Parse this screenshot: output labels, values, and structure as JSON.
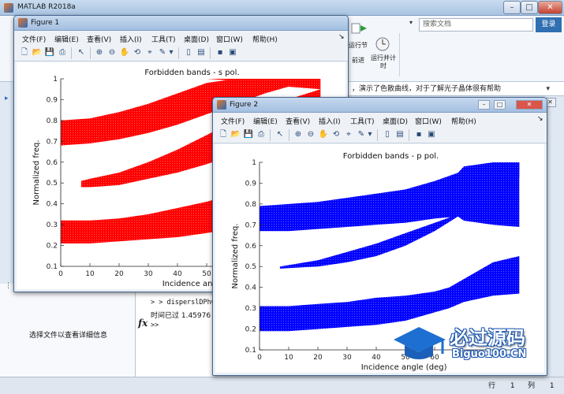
{
  "main_window": {
    "title": "MATLAB R2018a",
    "search_placeholder": "搜索文档",
    "login_label": "登录",
    "ribbon": {
      "run_section_label": "运行节",
      "advance_label": "前进",
      "run_timer_label": "运行并计时"
    },
    "address_text": "，演示了色散曲线，对于了解光子晶体很有帮助",
    "left_panel_text": "选择文件以查看详细信息",
    "command_lines": [
      "> > disperslDPhC",
      "时间已过 1.45976",
      ">>"
    ],
    "status": {
      "row_label": "行",
      "row_value": "1",
      "col_label": "列",
      "col_value": "1"
    }
  },
  "figure_menu": [
    "文件(F)",
    "编辑(E)",
    "查看(V)",
    "插入(I)",
    "工具(T)",
    "桌面(D)",
    "窗口(W)",
    "帮助(H)"
  ],
  "figure1": {
    "title": "Figure 1",
    "chart_data": {
      "type": "scatter",
      "title": "Forbidden bands - s pol.",
      "xlabel": "Incidence angle (deg)",
      "ylabel": "Normalized freq.",
      "xlim": [
        0,
        90
      ],
      "ylim": [
        0.1,
        1.0
      ],
      "xticks": [
        0,
        10,
        20,
        30,
        40,
        50,
        60
      ],
      "yticks": [
        0.1,
        0.2,
        0.3,
        0.4,
        0.5,
        0.6,
        0.7,
        0.8,
        0.9,
        1
      ],
      "color": "#ff0000",
      "bands": [
        {
          "x": [
            0,
            10,
            20,
            30,
            40,
            50,
            60,
            70,
            80,
            89
          ],
          "lower": [
            0.21,
            0.21,
            0.22,
            0.23,
            0.24,
            0.26,
            0.28,
            0.31,
            0.33,
            0.34
          ],
          "upper": [
            0.32,
            0.32,
            0.33,
            0.35,
            0.38,
            0.41,
            0.45,
            0.49,
            0.52,
            0.54
          ]
        },
        {
          "x": [
            7,
            10,
            20,
            30,
            40,
            50,
            60,
            70,
            80,
            89
          ],
          "lower": [
            0.48,
            0.48,
            0.49,
            0.52,
            0.55,
            0.59,
            0.64,
            0.68,
            0.71,
            0.73
          ],
          "upper": [
            0.51,
            0.52,
            0.55,
            0.6,
            0.66,
            0.73,
            0.8,
            0.86,
            0.91,
            0.95
          ]
        },
        {
          "x": [
            0,
            10,
            20,
            30,
            40,
            50,
            60,
            70,
            80,
            89
          ],
          "lower": [
            0.68,
            0.69,
            0.71,
            0.74,
            0.78,
            0.83,
            0.88,
            0.93,
            0.97,
            1.0
          ],
          "upper": [
            0.8,
            0.81,
            0.84,
            0.88,
            0.93,
            0.98,
            1.0,
            1.0,
            1.0,
            1.0
          ]
        },
        {
          "x": [
            50,
            60,
            70,
            80,
            89
          ],
          "lower": [
            1.0,
            0.99,
            0.97,
            0.96,
            0.95
          ],
          "upper": [
            1.0,
            1.0,
            1.0,
            1.0,
            1.0
          ]
        }
      ]
    }
  },
  "figure2": {
    "title": "Figure 2",
    "chart_data": {
      "type": "scatter",
      "title": "Forbidden bands - p pol.",
      "xlabel": "Incidence angle (deg)",
      "ylabel": "Normalized freq.",
      "xlim": [
        0,
        90
      ],
      "ylim": [
        0.1,
        1.0
      ],
      "xticks": [
        0,
        10,
        20,
        30,
        40,
        50,
        60
      ],
      "yticks": [
        0.1,
        0.2,
        0.3,
        0.4,
        0.5,
        0.6,
        0.7,
        0.8,
        0.9,
        1
      ],
      "color": "#0000ff",
      "bands": [
        {
          "x": [
            0,
            10,
            20,
            30,
            40,
            50,
            60,
            65,
            70,
            80,
            89
          ],
          "lower": [
            0.19,
            0.19,
            0.2,
            0.21,
            0.22,
            0.24,
            0.28,
            0.3,
            0.33,
            0.36,
            0.37
          ],
          "upper": [
            0.31,
            0.31,
            0.32,
            0.33,
            0.35,
            0.36,
            0.38,
            0.4,
            0.44,
            0.52,
            0.55
          ]
        },
        {
          "x": [
            7,
            20,
            30,
            40,
            50,
            60,
            68,
            70,
            80,
            89
          ],
          "lower": [
            0.49,
            0.5,
            0.52,
            0.55,
            0.6,
            0.67,
            0.74,
            0.78,
            0.87,
            0.93
          ],
          "upper": [
            0.5,
            0.53,
            0.57,
            0.61,
            0.66,
            0.71,
            0.75,
            0.82,
            0.99,
            1.0
          ]
        },
        {
          "x": [
            0,
            10,
            20,
            30,
            40,
            50,
            60,
            68,
            70,
            80,
            89
          ],
          "lower": [
            0.67,
            0.67,
            0.68,
            0.69,
            0.7,
            0.71,
            0.73,
            0.74,
            0.72,
            0.7,
            0.69
          ],
          "upper": [
            0.79,
            0.8,
            0.81,
            0.83,
            0.85,
            0.87,
            0.91,
            0.95,
            0.98,
            1.0,
            1.0
          ]
        }
      ]
    }
  },
  "watermark": {
    "main": "必过源码",
    "sub": "Biguo100.CN"
  }
}
